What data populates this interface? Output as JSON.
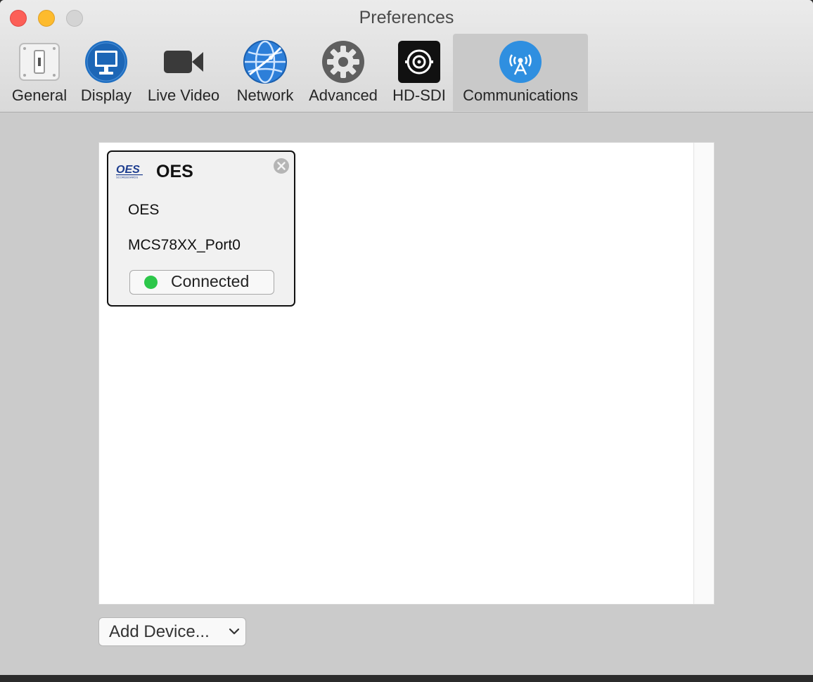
{
  "window": {
    "title": "Preferences"
  },
  "toolbar": {
    "tabs": [
      {
        "label": "General",
        "icon": "general-switch-icon"
      },
      {
        "label": "Display",
        "icon": "display-icon"
      },
      {
        "label": "Live Video",
        "icon": "video-camera-icon"
      },
      {
        "label": "Network",
        "icon": "globe-icon"
      },
      {
        "label": "Advanced",
        "icon": "gear-icon"
      },
      {
        "label": "HD-SDI",
        "icon": "bnc-connector-icon"
      },
      {
        "label": "Communications",
        "icon": "antenna-icon",
        "selected": true
      }
    ]
  },
  "device_card": {
    "logo_text": "OES",
    "logo_subtext": "SCOREBOARDS",
    "title": "OES",
    "manufacturer": "OES",
    "port": "MCS78XX_Port0",
    "status": "Connected",
    "status_color": "#2dc74a"
  },
  "footer": {
    "add_device_label": "Add Device..."
  },
  "colors": {
    "accent_blue": "#2f8fe0",
    "window_bg": "#cbcbcb"
  }
}
